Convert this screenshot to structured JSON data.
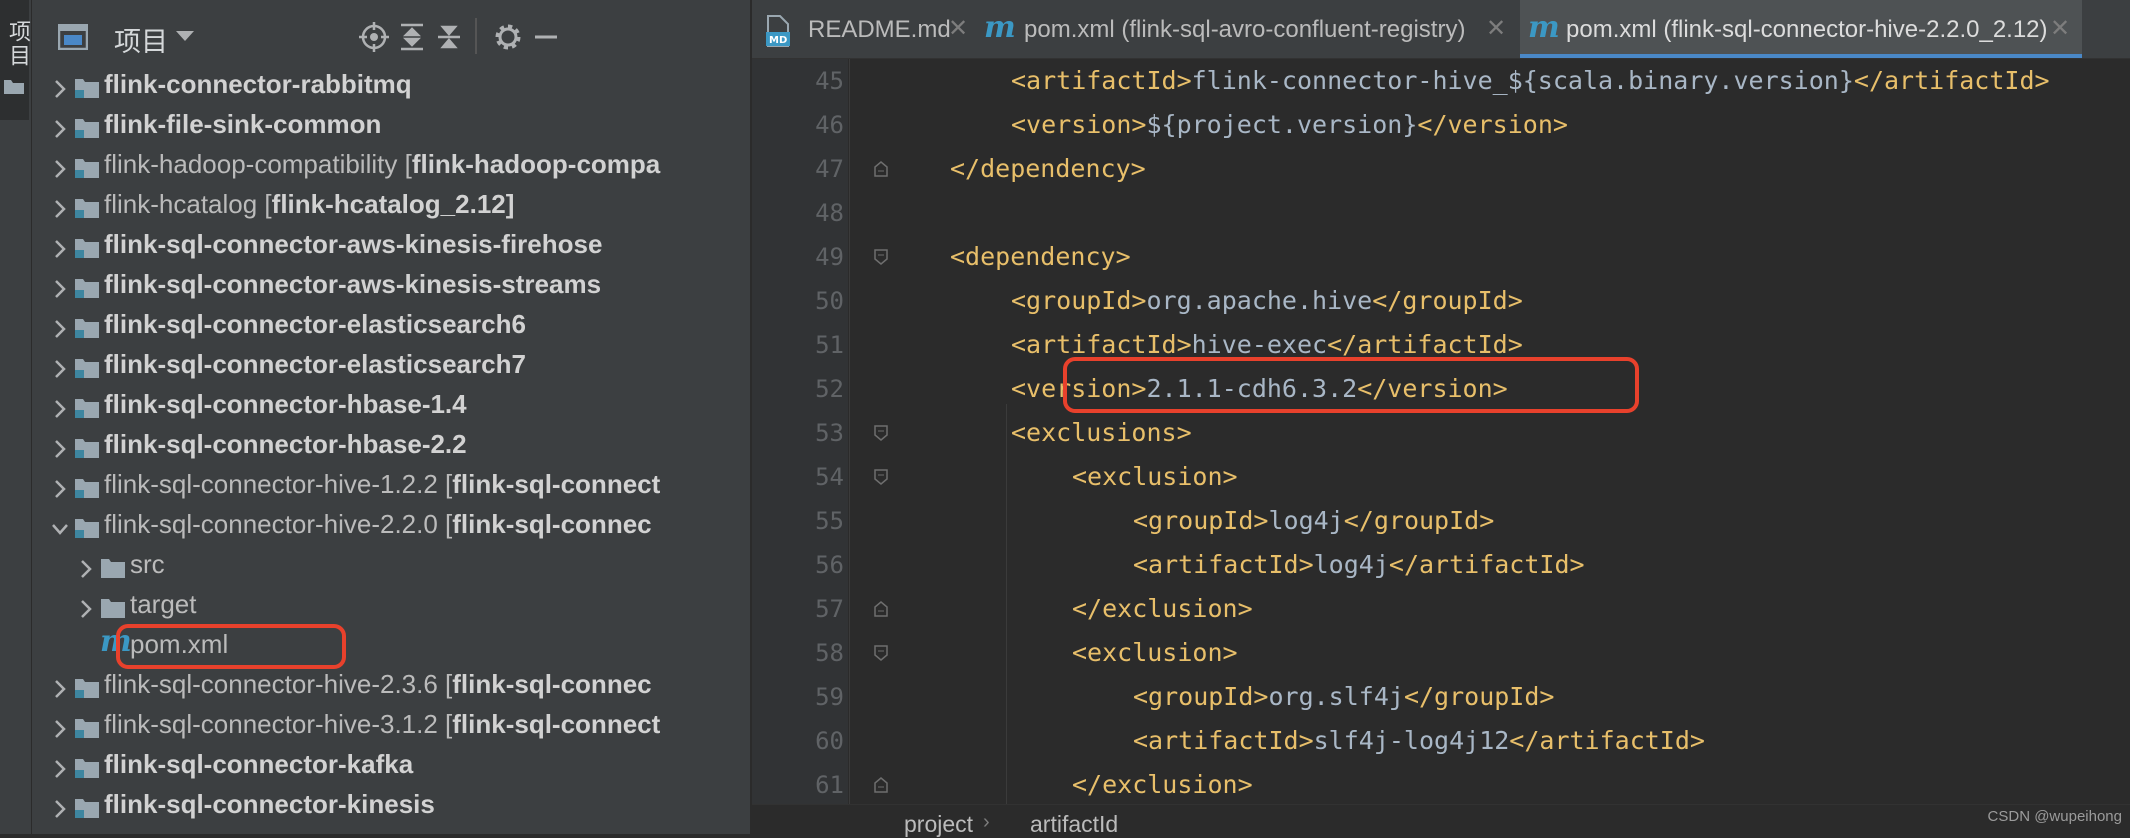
{
  "sidebar_strip": {
    "label": "项目"
  },
  "project_panel": {
    "title": "项目",
    "tree": [
      {
        "bold": "flink-connector-rabbitmq",
        "plain": "",
        "tail": "",
        "expanded": false,
        "level": 0,
        "kind": "module"
      },
      {
        "bold": "flink-file-sink-common",
        "plain": "",
        "tail": "",
        "expanded": false,
        "level": 0,
        "kind": "module"
      },
      {
        "bold": "",
        "plain": "flink-hadoop-compatibility [",
        "tail": "flink-hadoop-compa",
        "expanded": false,
        "level": 0,
        "kind": "module"
      },
      {
        "bold": "",
        "plain": "flink-hcatalog [",
        "tail": "flink-hcatalog_2.12]",
        "expanded": false,
        "level": 0,
        "kind": "module"
      },
      {
        "bold": "flink-sql-connector-aws-kinesis-firehose",
        "plain": "",
        "tail": "",
        "expanded": false,
        "level": 0,
        "kind": "module"
      },
      {
        "bold": "flink-sql-connector-aws-kinesis-streams",
        "plain": "",
        "tail": "",
        "expanded": false,
        "level": 0,
        "kind": "module"
      },
      {
        "bold": "flink-sql-connector-elasticsearch6",
        "plain": "",
        "tail": "",
        "expanded": false,
        "level": 0,
        "kind": "module"
      },
      {
        "bold": "flink-sql-connector-elasticsearch7",
        "plain": "",
        "tail": "",
        "expanded": false,
        "level": 0,
        "kind": "module"
      },
      {
        "bold": "flink-sql-connector-hbase-1.4",
        "plain": "",
        "tail": "",
        "expanded": false,
        "level": 0,
        "kind": "module"
      },
      {
        "bold": "flink-sql-connector-hbase-2.2",
        "plain": "",
        "tail": "",
        "expanded": false,
        "level": 0,
        "kind": "module"
      },
      {
        "bold": "",
        "plain": "flink-sql-connector-hive-1.2.2 [",
        "tail": "flink-sql-connect",
        "expanded": false,
        "level": 0,
        "kind": "module"
      },
      {
        "bold": "",
        "plain": "flink-sql-connector-hive-2.2.0 [",
        "tail": "flink-sql-connec",
        "expanded": true,
        "level": 0,
        "kind": "module"
      },
      {
        "bold": "",
        "plain": "src",
        "tail": "",
        "expanded": false,
        "level": 1,
        "kind": "folder"
      },
      {
        "bold": "",
        "plain": "target",
        "tail": "",
        "expanded": false,
        "level": 1,
        "kind": "folder"
      },
      {
        "bold": "",
        "plain": "pom.xml",
        "tail": "",
        "expanded": false,
        "level": 1,
        "kind": "maven"
      },
      {
        "bold": "",
        "plain": "flink-sql-connector-hive-2.3.6 [",
        "tail": "flink-sql-connec",
        "expanded": false,
        "level": 0,
        "kind": "module"
      },
      {
        "bold": "",
        "plain": "flink-sql-connector-hive-3.1.2 [",
        "tail": "flink-sql-connect",
        "expanded": false,
        "level": 0,
        "kind": "module"
      },
      {
        "bold": "flink-sql-connector-kafka",
        "plain": "",
        "tail": "",
        "expanded": false,
        "level": 0,
        "kind": "module"
      },
      {
        "bold": "flink-sql-connector-kinesis",
        "plain": "",
        "tail": "",
        "expanded": false,
        "level": 0,
        "kind": "module"
      }
    ]
  },
  "tabs": [
    {
      "icon": "markdown-icon",
      "label": "README.md",
      "active": false
    },
    {
      "icon": "maven-icon",
      "label": "pom.xml (flink-sql-avro-confluent-registry)",
      "active": false
    },
    {
      "icon": "maven-icon",
      "label": "pom.xml (flink-sql-connector-hive-2.2.0_2.12)",
      "active": true
    }
  ],
  "editor": {
    "lines": [
      {
        "n": "45",
        "indent": 2,
        "open": "<artifactId>",
        "text": "flink-connector-hive_${scala.binary.version}",
        "close": "</artifactId>"
      },
      {
        "n": "46",
        "indent": 2,
        "open": "<version>",
        "text": "${project.version}",
        "close": "</version>"
      },
      {
        "n": "47",
        "indent": 1,
        "open": "</dependency>",
        "text": "",
        "close": ""
      },
      {
        "n": "48",
        "indent": 0,
        "open": "",
        "text": "",
        "close": ""
      },
      {
        "n": "49",
        "indent": 1,
        "open": "<dependency>",
        "text": "",
        "close": ""
      },
      {
        "n": "50",
        "indent": 2,
        "open": "<groupId>",
        "text": "org.apache.hive",
        "close": "</groupId>"
      },
      {
        "n": "51",
        "indent": 2,
        "open": "<artifactId>",
        "text": "hive-exec",
        "close": "</artifactId>"
      },
      {
        "n": "52",
        "indent": 2,
        "open": "<version>",
        "text": "2.1.1-cdh6.3.2",
        "close": "</version>"
      },
      {
        "n": "53",
        "indent": 2,
        "open": "<exclusions>",
        "text": "",
        "close": ""
      },
      {
        "n": "54",
        "indent": 3,
        "open": "<exclusion>",
        "text": "",
        "close": ""
      },
      {
        "n": "55",
        "indent": 4,
        "open": "<groupId>",
        "text": "log4j",
        "close": "</groupId>"
      },
      {
        "n": "56",
        "indent": 4,
        "open": "<artifactId>",
        "text": "log4j",
        "close": "</artifactId>"
      },
      {
        "n": "57",
        "indent": 3,
        "open": "</exclusion>",
        "text": "",
        "close": ""
      },
      {
        "n": "58",
        "indent": 3,
        "open": "<exclusion>",
        "text": "",
        "close": ""
      },
      {
        "n": "59",
        "indent": 4,
        "open": "<groupId>",
        "text": "org.slf4j",
        "close": "</groupId>"
      },
      {
        "n": "60",
        "indent": 4,
        "open": "<artifactId>",
        "text": "slf4j-log4j12",
        "close": "</artifactId>"
      },
      {
        "n": "61",
        "indent": 3,
        "open": "</exclusion>",
        "text": "",
        "close": ""
      }
    ]
  },
  "breadcrumb": [
    "project",
    "artifactId"
  ],
  "watermark": "CSDN @wupeihong",
  "colors": {
    "highlight": "#e8412c",
    "tag": "#e8bf6a",
    "maven": "#3b98c4",
    "tab_underline": "#4a88c7"
  }
}
